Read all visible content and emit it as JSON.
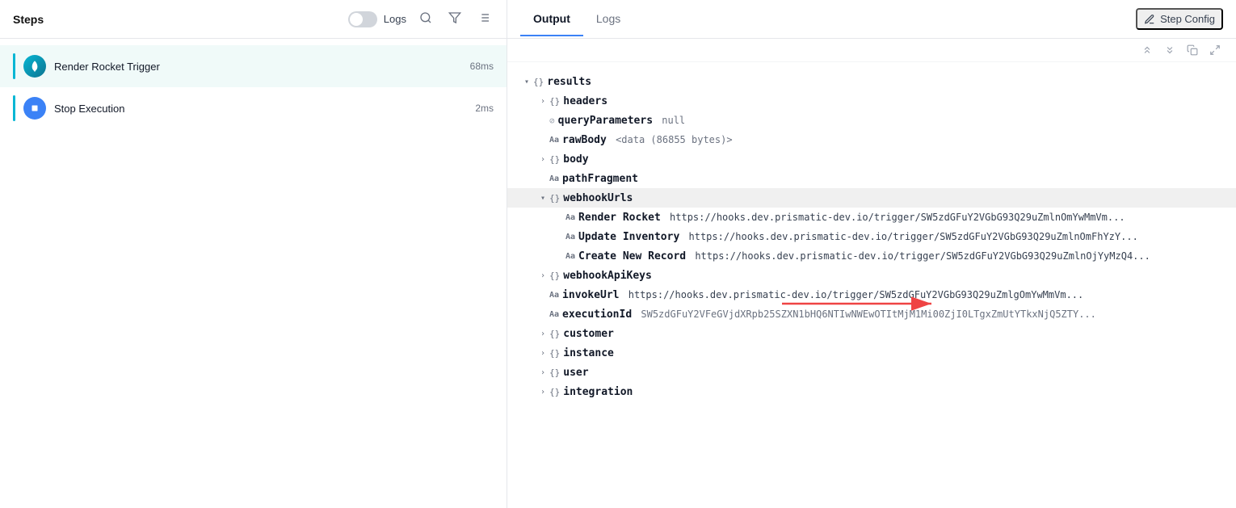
{
  "left": {
    "title": "Steps",
    "logs_label": "Logs",
    "toggle_on": false,
    "steps": [
      {
        "id": "render-rocket-trigger",
        "name": "Render Rocket Trigger",
        "time": "68ms",
        "icon_type": "rocket",
        "active": true
      },
      {
        "id": "stop-execution",
        "name": "Stop Execution",
        "time": "2ms",
        "icon_type": "stop",
        "active": false
      }
    ]
  },
  "right": {
    "tabs": [
      {
        "id": "output",
        "label": "Output",
        "active": true
      },
      {
        "id": "logs",
        "label": "Logs",
        "active": false
      }
    ],
    "step_config_label": "Step Config",
    "tree": {
      "results": {
        "headers": {},
        "queryParameters": "null",
        "rawBody": "<data (86855 bytes)>",
        "body": {},
        "pathFragment": "",
        "webhookUrls": {
          "renderRocket": "https://hooks.dev.prismatic-dev.io/trigger/SW5zdGFuY2VGbG93Q29uZmlnOmYwMmVm...",
          "updateInventory": "https://hooks.dev.prismatic-dev.io/trigger/SW5zdGFuY2VGbG93Q29uZmlnOmFhYzY...",
          "createNewRecord": "https://hooks.dev.prismatic-dev.io/trigger/SW5zdGFuY2VGbG93Q29uZmlnOjYyMzQ4..."
        },
        "webhookApiKeys": {},
        "invokeUrl": "https://hooks.dev.prismatic-dev.io/trigger/SW5zdGFuY2VGbG93Q29uZmlgOmYwMmVm...",
        "executionId": "SW5zdGFuY2VFeGVjdXRpb25SZXN1bHQ6NTIwNWEwOTItMjM1Mi00ZjI0LTgxZmUtYTkxNjQ5ZTY...",
        "customer": {},
        "instance": {},
        "user": {},
        "integration": {}
      }
    },
    "tree_items": [
      {
        "indent": 0,
        "expanded": true,
        "key": "results",
        "icon": "obj",
        "value": "",
        "type": "parent"
      },
      {
        "indent": 1,
        "expanded": false,
        "key": "headers",
        "icon": "obj",
        "value": "",
        "type": "parent"
      },
      {
        "indent": 1,
        "expanded": false,
        "key": "queryParameters",
        "icon": "no",
        "value": "null",
        "type": "leaf"
      },
      {
        "indent": 1,
        "expanded": false,
        "key": "rawBody",
        "icon": "str",
        "value": "<data (86855 bytes)>",
        "type": "leaf"
      },
      {
        "indent": 1,
        "expanded": false,
        "key": "body",
        "icon": "obj",
        "value": "",
        "type": "parent"
      },
      {
        "indent": 1,
        "expanded": false,
        "key": "pathFragment",
        "icon": "str",
        "value": "",
        "type": "leaf"
      },
      {
        "indent": 1,
        "expanded": true,
        "key": "webhookUrls",
        "icon": "obj",
        "value": "",
        "type": "parent",
        "highlighted": true
      },
      {
        "indent": 2,
        "expanded": false,
        "key": "Render Rocket",
        "icon": "str",
        "value": "https://hooks.dev.prismatic-dev.io/trigger/SW5zdGFuY2VGbG93Q29uZmlnOmYwMmVm...",
        "type": "leaf"
      },
      {
        "indent": 2,
        "expanded": false,
        "key": "Update Inventory",
        "icon": "str",
        "value": "https://hooks.dev.prismatic-dev.io/trigger/SW5zdGFuY2VGbG93Q29uZmlnOmFhYzY...",
        "type": "leaf"
      },
      {
        "indent": 2,
        "expanded": false,
        "key": "Create New Record",
        "icon": "str",
        "value": "https://hooks.dev.prismatic-dev.io/trigger/SW5zdGFuY2VGbG93Q29uZmlnOjYyMzQ4...",
        "type": "leaf"
      },
      {
        "indent": 1,
        "expanded": false,
        "key": "webhookApiKeys",
        "icon": "obj",
        "value": "",
        "type": "parent"
      },
      {
        "indent": 1,
        "expanded": false,
        "key": "invokeUrl",
        "icon": "str",
        "value": "https://hooks.dev.prismatic-dev.io/trigger/SW5zdGFuY2VGbG93Q29uZmlgOmYwMmVm...",
        "type": "leaf"
      },
      {
        "indent": 1,
        "expanded": false,
        "key": "executionId",
        "icon": "str",
        "value": "SW5zdGFuY2VFeGVjdXRpb25SZXN1bHQ6NTIwNWEwOTItMjM1Mi00ZjI0LTgxZmUtYTkxNjQ5ZTY...",
        "type": "leaf"
      },
      {
        "indent": 1,
        "expanded": false,
        "key": "customer",
        "icon": "obj",
        "value": "",
        "type": "parent"
      },
      {
        "indent": 1,
        "expanded": false,
        "key": "instance",
        "icon": "obj",
        "value": "",
        "type": "parent"
      },
      {
        "indent": 1,
        "expanded": false,
        "key": "user",
        "icon": "obj",
        "value": "",
        "type": "parent"
      },
      {
        "indent": 1,
        "expanded": false,
        "key": "integration",
        "icon": "obj",
        "value": "",
        "type": "parent"
      }
    ]
  },
  "icons": {
    "search": "🔍",
    "filter": "⬡",
    "sort": "☰",
    "edit": "✏️",
    "collapse_all": "⇅",
    "copy": "⧉",
    "expand": "⛶",
    "chevron_right": "›",
    "chevron_down": "⌄"
  }
}
